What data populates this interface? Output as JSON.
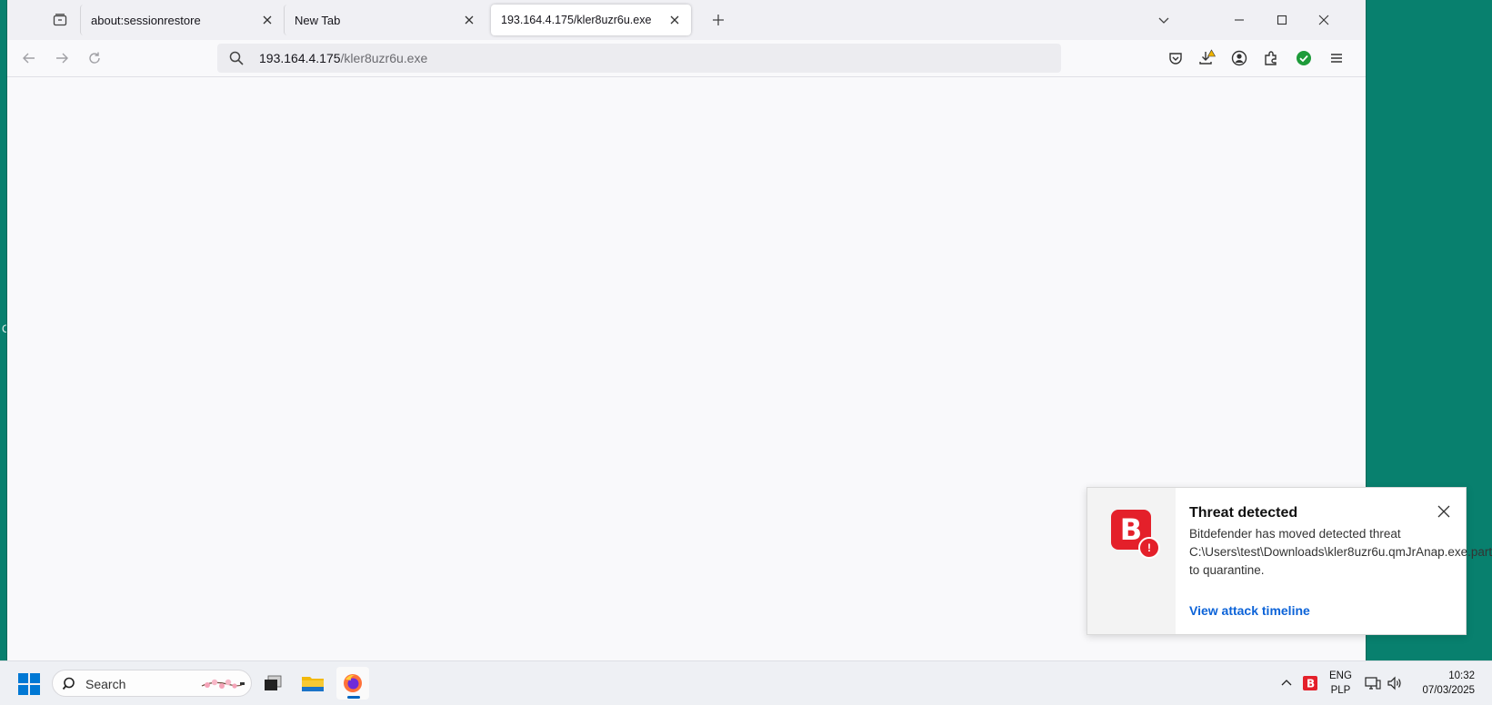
{
  "desktop": {
    "edge_char": "C",
    "background_color": "#08806e"
  },
  "browser": {
    "tabs": [
      {
        "title": "about:sessionrestore",
        "active": false
      },
      {
        "title": "New Tab",
        "active": false
      },
      {
        "title": "193.164.4.175/kler8uzr6u.exe",
        "active": true
      }
    ],
    "urlbar": {
      "host": "193.164.4.175",
      "path": "/kler8uzr6u.exe"
    },
    "toolbar_icons": [
      "pocket-icon",
      "downloads-icon",
      "account-icon",
      "extensions-icon",
      "bitdefender-check-icon",
      "menu-icon"
    ]
  },
  "notification": {
    "app_icon_letter": "B",
    "badge": "!",
    "title": "Threat detected",
    "body": "Bitdefender has moved detected threat C:\\Users\\test\\Downloads\\kler8uzr6u.qmJrAnap.exe.part to quarantine.",
    "link": "View attack timeline",
    "accent": "#e4202a",
    "link_color": "#0c63d8"
  },
  "taskbar": {
    "search_label": "Search",
    "language": {
      "line1": "ENG",
      "line2": "PLP"
    },
    "clock": {
      "time": "10:32",
      "date": "07/03/2025"
    }
  }
}
